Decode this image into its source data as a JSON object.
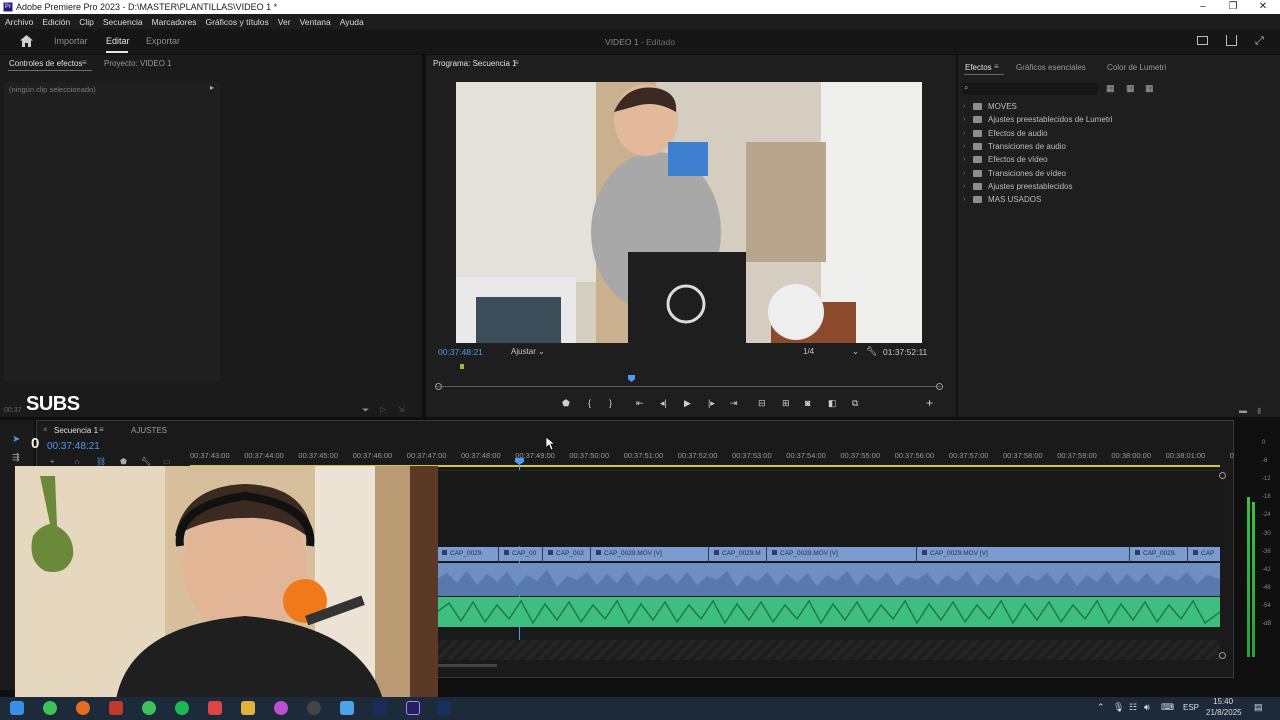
{
  "window": {
    "title": "Adobe Premiere Pro 2023 - D:\\MASTER\\PLANTILLAS\\VIDEO 1 *",
    "logo_text": "Pr"
  },
  "menu": [
    "Archivo",
    "Edición",
    "Clip",
    "Secuencia",
    "Marcadores",
    "Gráficos y títulos",
    "Ver",
    "Ventana",
    "Ayuda"
  ],
  "workspace": {
    "tabs": [
      "Importar",
      "Editar",
      "Exportar"
    ],
    "active_tab": "Editar",
    "project_title": "VIDEO 1",
    "project_status": " - Editado"
  },
  "left_panel": {
    "tab_effect_controls": "Controles de efectos",
    "tab_project": "Proyecto: VIDEO 1",
    "no_clip": "(ningún clip seleccionado)",
    "overlay_text": "SUBS",
    "mini_timecode": "00:37"
  },
  "program": {
    "tab": "Programa: Secuencia 1",
    "timecode": "00:37:48:21",
    "fit": "Ajustar",
    "resolution": "1/4",
    "duration": "01:37:52:11",
    "playhead_fraction": 0.38
  },
  "effects": {
    "tabs": [
      "Efectos",
      "Gráficos esenciales",
      "Color de Lumetri"
    ],
    "items": [
      "MOVES",
      "Ajustes preestablecidos de Lumetri",
      "Efectos de audio",
      "Transiciones de audio",
      "Efectos de vídeo",
      "Transiciones de vídeo",
      "Ajustes preestablecidos",
      "MAS USADOS"
    ]
  },
  "timeline": {
    "tabs": [
      "Secuencia 1",
      "AJUSTES"
    ],
    "timecode": "00:37:48:21",
    "ruler_labels": [
      "00:37:43:00",
      "00:37:44:00",
      "00:37:45:00",
      "00:37:46:00",
      "00:37:47:00",
      "00:37:48:00",
      "00:37:49:00",
      "00:37:50:00",
      "00:37:51:00",
      "00:37:52:00",
      "00:37:53:00",
      "00:37:54:00",
      "00:37:55:00",
      "00:37:56:00",
      "00:37:57:00",
      "00:37:58:00",
      "00:37:59:00",
      "00:38:00:00",
      "00:38:01:00",
      "0"
    ],
    "clips": [
      "CAP_0029.",
      "CAP_00",
      "CAP_002",
      "CAP_0029.MOV [V]",
      "CAP_0029.M",
      "CAP_0029.MOV [V]",
      "CAP_0029.MOV [V]",
      "CAP_0029.",
      "CAP"
    ],
    "left_digit": "0"
  },
  "meter_labels": [
    "0",
    "-6",
    "-12",
    "-18",
    "-24",
    "-30",
    "-36",
    "-42",
    "-48",
    "-54",
    "-dB"
  ],
  "taskbar": {
    "language": "ESP",
    "time": "15:40",
    "date": "21/8/2025"
  },
  "colors": {
    "accent_blue": "#2d8ceb",
    "clip_video": "#7b9bd1",
    "clip_audio1": "#6f8fc4",
    "clip_audio2": "#3fbf7f",
    "playhead": "#4a9cf0"
  }
}
